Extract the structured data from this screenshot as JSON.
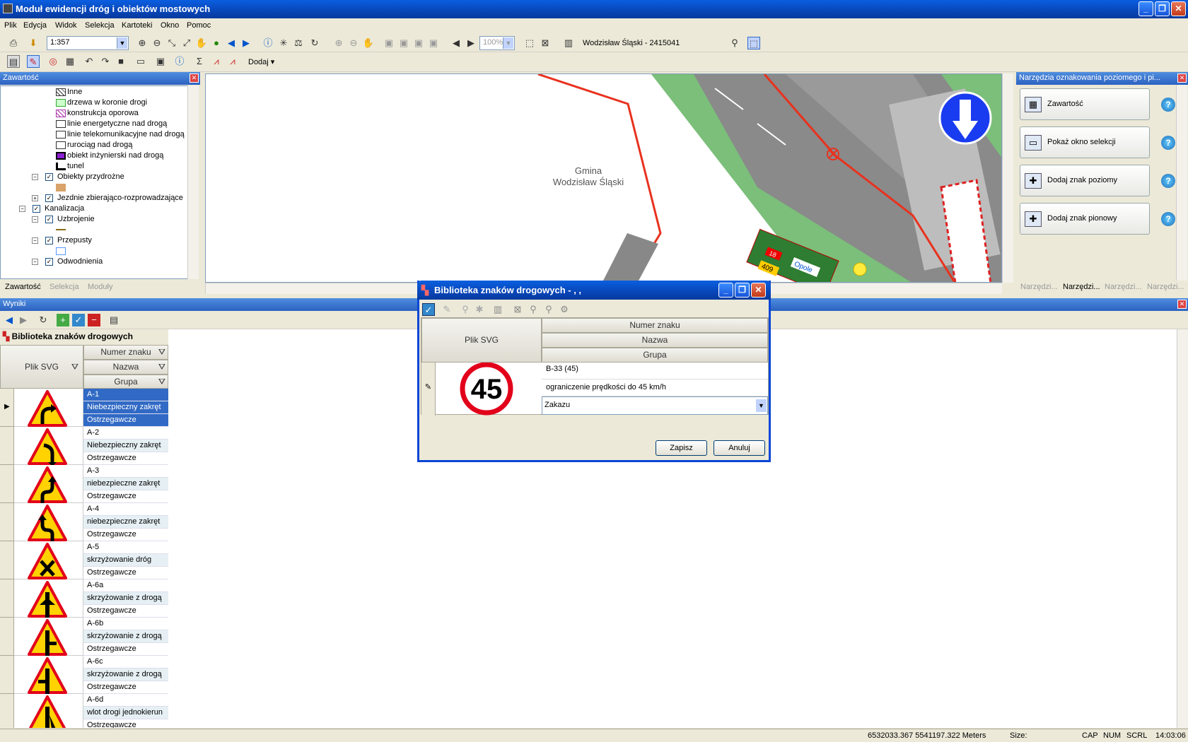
{
  "app": {
    "title": "Moduł ewidencji dróg i obiektów mostowych"
  },
  "menu": [
    "Plik",
    "Edycja",
    "Widok",
    "Selekcja",
    "Kartoteki",
    "Okno",
    "Pomoc"
  ],
  "toolbar": {
    "scale_value": "1:357",
    "zoom_value": "100%",
    "location_text": "Wodzisław Śląski - 2415041",
    "add_label": "Dodaj"
  },
  "contents_panel": {
    "title": "Zawartość",
    "items": [
      {
        "label": "Inne",
        "indent": 2,
        "symbol": "hatch"
      },
      {
        "label": "drzewa w koronie drogi",
        "indent": 2,
        "symbol": "green"
      },
      {
        "label": "konstrukcja oporowa",
        "indent": 2,
        "symbol": "purplehatch"
      },
      {
        "label": "linie energetyczne nad drogą",
        "indent": 2,
        "symbol": "pole"
      },
      {
        "label": "linie telekomunikacyjne nad drogą",
        "indent": 2,
        "symbol": "plain"
      },
      {
        "label": "rurociąg nad drogą",
        "indent": 2,
        "symbol": "pipe"
      },
      {
        "label": "obiekt inżynierski nad drogą",
        "indent": 2,
        "symbol": "purple"
      },
      {
        "label": "tunel",
        "indent": 2,
        "symbol": "tunnel"
      },
      {
        "label": "Obiekty przydrożne",
        "indent": 1,
        "checked": true,
        "expander": "−"
      },
      {
        "label": "",
        "indent": 2,
        "symbol": "tan"
      },
      {
        "label": "Jezdnie zbierająco-rozprowadzające",
        "indent": 1,
        "checked": true,
        "expander": "+"
      },
      {
        "label": "Kanalizacja",
        "indent": 0,
        "checked": true,
        "expander": "−"
      },
      {
        "label": "Uzbrojenie",
        "indent": 1,
        "checked": true,
        "expander": "−"
      },
      {
        "label": "",
        "indent": 2,
        "symbol": "line"
      },
      {
        "label": "Przepusty",
        "indent": 1,
        "checked": true,
        "expander": "−"
      },
      {
        "label": "",
        "indent": 2,
        "symbol": "culvert"
      },
      {
        "label": "Odwodnienia",
        "indent": 1,
        "checked": true,
        "expander": "−"
      }
    ],
    "tabs": [
      "Zawartość",
      "Selekcja",
      "Moduły"
    ]
  },
  "map": {
    "label_line1": "Gmina",
    "label_line2": "Wodzisław Śląski",
    "sign_number": "18",
    "sign_road": "409",
    "sign_city": "Opole"
  },
  "tools_panel": {
    "title": "Narzędzia oznakowania poziomego i pi...",
    "buttons": [
      "Zawartość",
      "Pokaż okno selekcji",
      "Dodaj znak poziomy",
      "Dodaj znak pionowy"
    ],
    "tabs": [
      "Narzędzi...",
      "Narzędzi...",
      "Narzędzi...",
      "Narzędzi..."
    ]
  },
  "results_panel": {
    "title": "Wyniki",
    "grid_title": "Biblioteka znaków drogowych",
    "columns": {
      "svg": "Plik SVG",
      "number": "Numer znaku",
      "name": "Nazwa",
      "group": "Grupa"
    },
    "rows": [
      {
        "number": "A-1",
        "name": "Niebezpieczny zakręt",
        "group": "Ostrzegawcze",
        "selected": true,
        "icon": "curve-right-warning-icon"
      },
      {
        "number": "A-2",
        "name": "Niebezpieczny zakręt",
        "group": "Ostrzegawcze",
        "icon": "curve-left-warning-icon"
      },
      {
        "number": "A-3",
        "name": "niebezpieczne zakręt",
        "group": "Ostrzegawcze",
        "icon": "double-curve-right-warning-icon"
      },
      {
        "number": "A-4",
        "name": "niebezpieczne zakręt",
        "group": "Ostrzegawcze",
        "icon": "double-curve-left-warning-icon"
      },
      {
        "number": "A-5",
        "name": "skrzyżowanie dróg",
        "group": "Ostrzegawcze",
        "icon": "crossroads-warning-icon"
      },
      {
        "number": "A-6a",
        "name": "skrzyżowanie z drogą",
        "group": "Ostrzegawcze",
        "icon": "side-road-both-warning-icon"
      },
      {
        "number": "A-6b",
        "name": "skrzyżowanie z drogą",
        "group": "Ostrzegawcze",
        "icon": "side-road-right-warning-icon"
      },
      {
        "number": "A-6c",
        "name": "skrzyżowanie z drogą",
        "group": "Ostrzegawcze",
        "icon": "side-road-left-warning-icon"
      },
      {
        "number": "A-6d",
        "name": "wlot drogi jednokierun",
        "group": "Ostrzegawcze",
        "icon": "one-way-entry-warning-icon"
      }
    ]
  },
  "dialog": {
    "title": "Biblioteka znaków drogowych - , ,",
    "col_svg": "Plik SVG",
    "col_number": "Numer znaku",
    "col_name": "Nazwa",
    "col_group": "Grupa",
    "sign_value": "45",
    "number_value": "B-33 (45)",
    "name_value": "ograniczenie prędkości do 45 km/h",
    "group_value": "Zakazu",
    "save_label": "Zapisz",
    "cancel_label": "Anuluj"
  },
  "status": {
    "coords": "6532033.367 5541197.322 Meters",
    "size": "Size:",
    "caps": "CAP",
    "num": "NUM",
    "scrl": "SCRL",
    "time": "14:03:06"
  },
  "colors": {
    "title": "#0846b8",
    "selection": "#316ac5",
    "road_red": "#e8321e",
    "grass": "#7bbf7a"
  }
}
